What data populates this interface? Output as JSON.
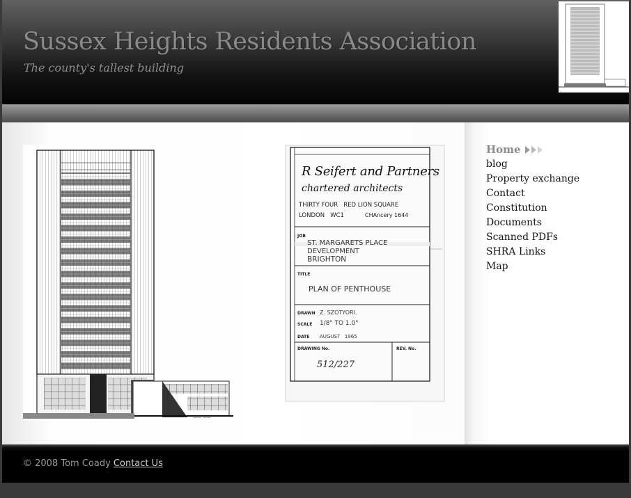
{
  "header": {
    "title": "Sussex Heights Residents Association",
    "tagline": "The county's tallest building"
  },
  "nav": {
    "items": [
      {
        "label": "Home",
        "current": true
      },
      {
        "label": "blog"
      },
      {
        "label": "Property exchange"
      },
      {
        "label": "Contact"
      },
      {
        "label": "Constitution"
      },
      {
        "label": "Documents"
      },
      {
        "label": "Scanned PDFs"
      },
      {
        "label": "SHRA Links"
      },
      {
        "label": "Map"
      }
    ]
  },
  "title_block": {
    "firm_line1": "R Seifert and Partners",
    "firm_line2": "chartered architects",
    "address_line1": "THIRTY FOUR   RED LION SQUARE",
    "address_line2": "LONDON   WC1",
    "phone": "CHAncery 1644",
    "job_label": "JOB",
    "job_line1": "ST. MARGARETS PLACE",
    "job_line2": "DEVELOPMENT",
    "job_line3": "BRIGHTON",
    "title_label": "TITLE",
    "title_value": "PLAN OF PENTHOUSE",
    "drawn_label": "DRAWN",
    "drawn_value": "Z. SZOTYORI.",
    "scale_label": "SCALE",
    "scale_value": "1/8\" TO 1.0\"",
    "date_label": "DATE",
    "date_value": "AUGUST   1965",
    "drawing_no_label": "DRAWING No.",
    "drawing_no_value": "512/227",
    "rev_label": "REV. No."
  },
  "footer": {
    "copyright": "© 2008 Tom Coady",
    "contact_link": "Contact Us"
  },
  "colors": {
    "header_title": "#8a8a8a",
    "nav_current": "#8c8c8c",
    "nav_text": "#111111",
    "footer_text": "#9a9a9a"
  }
}
